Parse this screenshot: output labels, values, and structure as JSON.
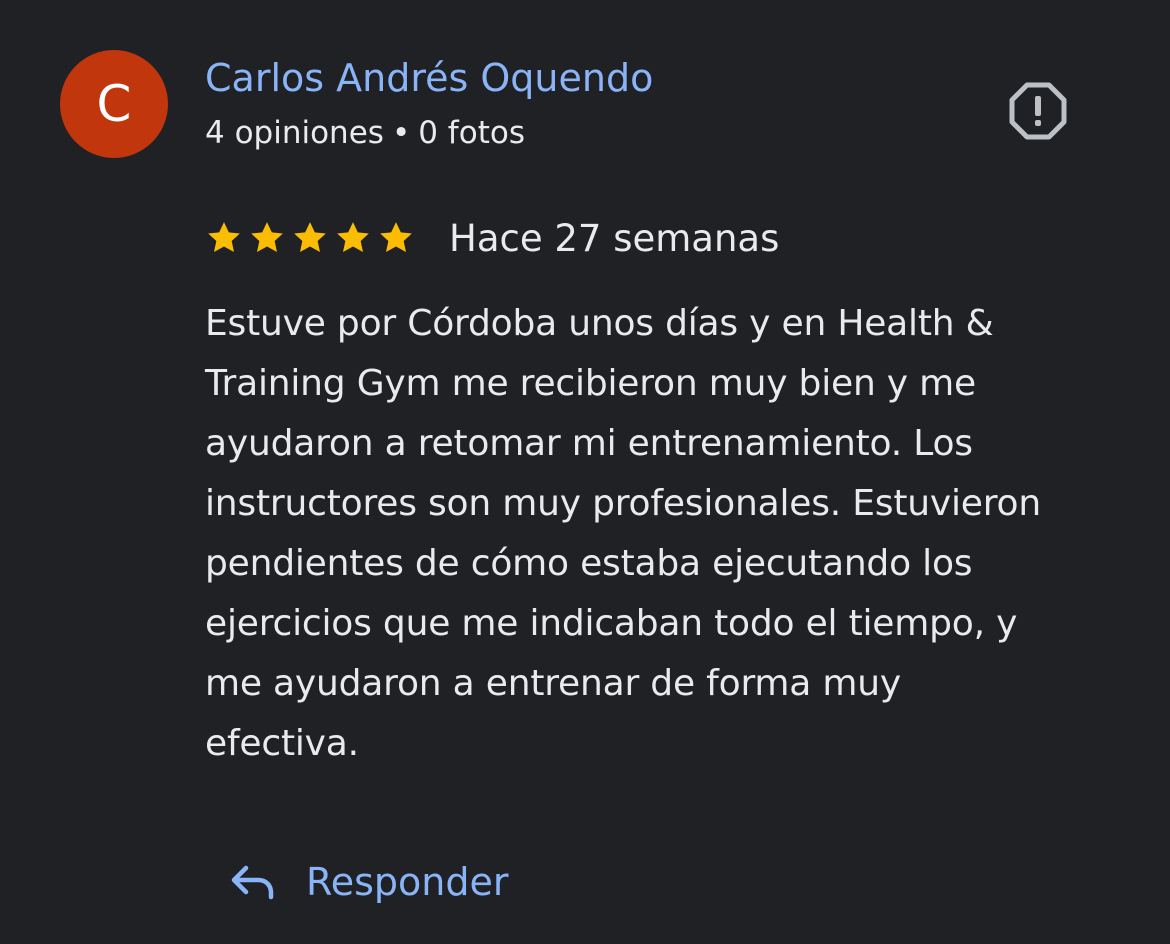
{
  "review": {
    "author": {
      "initial": "C",
      "name": "Carlos Andrés Oquendo",
      "reviews_count": "4 opiniones",
      "separator": "•",
      "photos_count": "0 fotos",
      "avatar_color": "#c1360c"
    },
    "rating": 5,
    "rating_max": 5,
    "time": "Hace 27 semanas",
    "text_lines": [
      "Estuve por Córdoba unos días y en Health &",
      "Training Gym me recibieron muy bien y me",
      "ayudaron a retomar mi entrenamiento. Los",
      "instructores son muy profesionales. Estuvieron",
      "pendientes de cómo estaba ejecutando los",
      "ejercicios que me indicaban todo el tiempo, y",
      "me ayudaron a entrenar de forma muy",
      "efectiva."
    ],
    "report_icon": "report-octagon-icon",
    "star_icon": "star-icon",
    "star_color": "#fbbc04"
  },
  "actions": {
    "reply_label": "Responder",
    "reply_icon": "reply-arrow-icon",
    "link_color": "#8ab4f8"
  }
}
